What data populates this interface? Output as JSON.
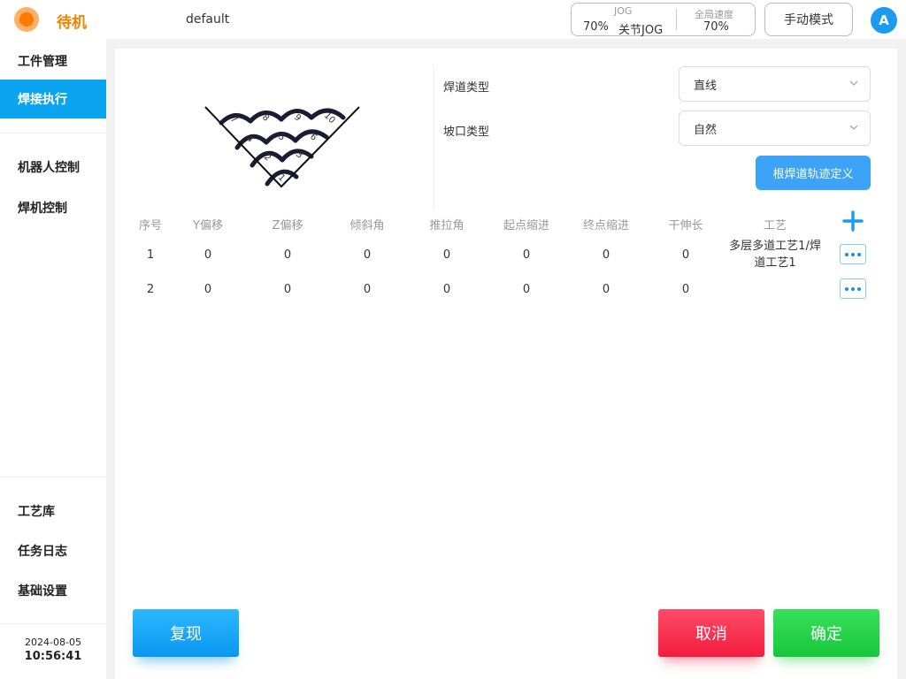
{
  "header": {
    "status": "待机",
    "program": "default",
    "jog": {
      "label": "JOG",
      "percent": "70%",
      "mode": "关节JOG"
    },
    "speed": {
      "label": "全局速度",
      "percent": "70%"
    },
    "mode_button": "手动模式",
    "avatar": "A"
  },
  "colors": {
    "accent": "#0aa4f0",
    "status": "#f08300",
    "cancel": "#f21c3f",
    "confirm": "#17c63c"
  },
  "sidebar": {
    "top": [
      "工件管理",
      "焊接执行"
    ],
    "middle": [
      "机器人控制",
      "焊机控制"
    ],
    "bottom": [
      "工艺库",
      "任务日志",
      "基础设置"
    ],
    "active": "焊接执行",
    "date": "2024-08-05",
    "time": "10:56:41"
  },
  "diagram": {
    "labels": [
      "1",
      "2",
      "3",
      "4",
      "5",
      "6",
      "7",
      "8",
      "9",
      "10"
    ]
  },
  "form": {
    "weld_type_label": "焊道类型",
    "weld_type_value": "直线",
    "groove_type_label": "坡口类型",
    "groove_type_value": "自然",
    "define_button": "根焊道轨迹定义"
  },
  "table": {
    "headers": [
      "序号",
      "Y偏移",
      "Z偏移",
      "倾斜角",
      "推拉角",
      "起点缩进",
      "终点缩进",
      "干伸长",
      "工艺"
    ],
    "rows": [
      [
        "1",
        "0",
        "0",
        "0",
        "0",
        "0",
        "0",
        "0",
        "多层多道工艺1/焊",
        "道工艺1"
      ],
      [
        "2",
        "0",
        "0",
        "0",
        "0",
        "0",
        "0",
        "0",
        "",
        ""
      ]
    ]
  },
  "buttons": {
    "replay": "复现",
    "cancel": "取消",
    "confirm": "确定"
  }
}
